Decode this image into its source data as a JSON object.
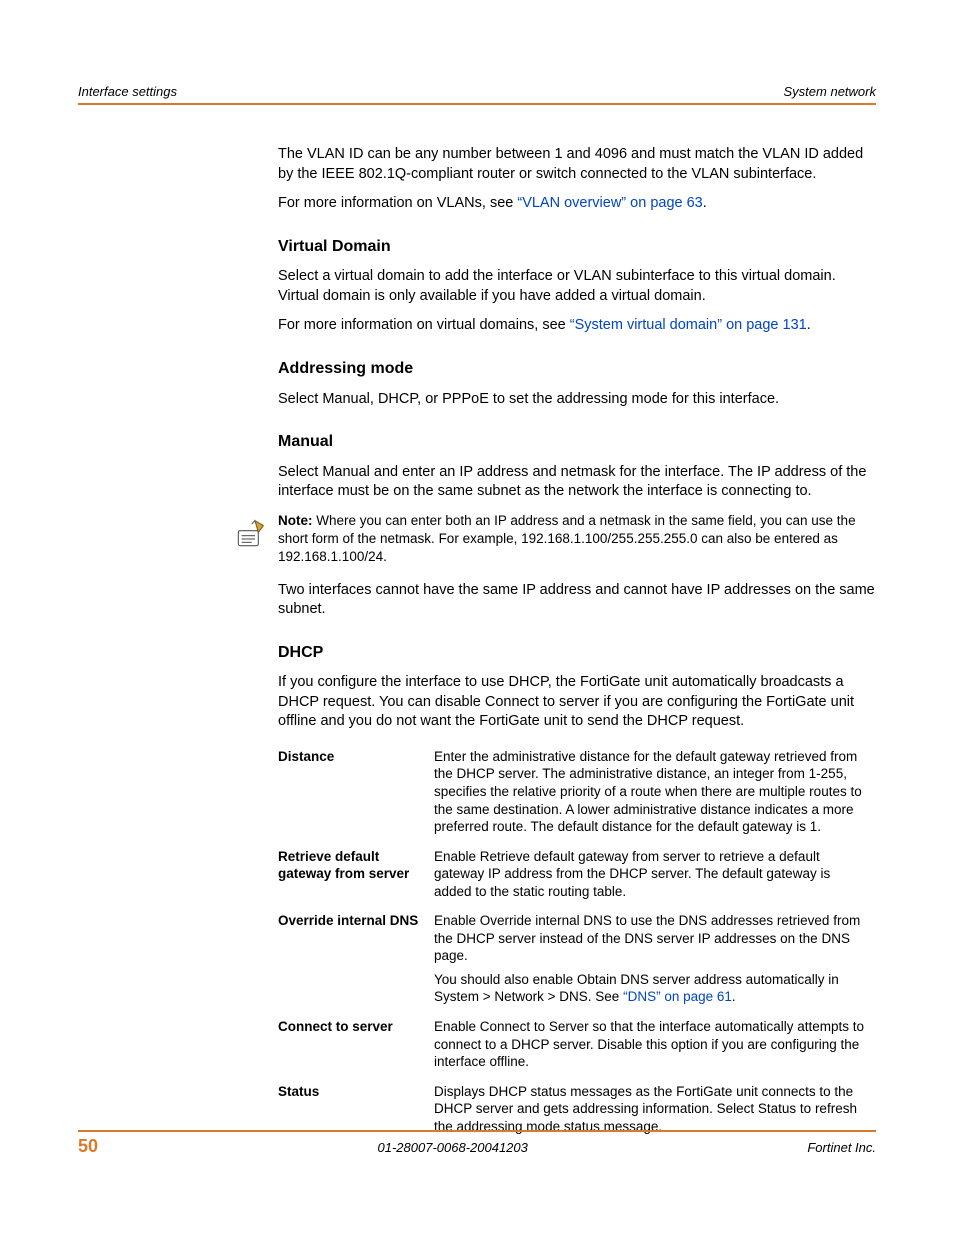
{
  "header": {
    "left": "Interface settings",
    "right": "System network"
  },
  "body": {
    "p1": "The VLAN ID can be any number between 1 and 4096 and must match the VLAN ID added by the IEEE 802.1Q-compliant router or switch connected to the VLAN subinterface.",
    "p2a": "For more information on VLANs, see ",
    "p2link": "“VLAN overview” on page 63",
    "p2b": ".",
    "h_vdom": "Virtual Domain",
    "vdom_p1": "Select a virtual domain to add the interface or VLAN subinterface to this virtual domain. Virtual domain is only available if you have added a virtual domain.",
    "vdom_p2a": "For more information on virtual domains, see ",
    "vdom_p2link": "“System virtual domain” on page 131",
    "vdom_p2b": ".",
    "h_addr": "Addressing mode",
    "addr_p1": "Select Manual, DHCP, or PPPoE to set the addressing mode for this interface.",
    "h_manual": "Manual",
    "manual_p1": "Select Manual and enter an IP address and netmask for the interface. The IP address of the interface must be on the same subnet as the network the interface is connecting to.",
    "note_label": "Note:",
    "note_text": " Where you can enter both an IP address and a netmask in the same field, you can use the short form of the netmask. For example, 192.168.1.100/255.255.255.0 can also be entered as 192.168.1.100/24.",
    "manual_p2": "Two interfaces cannot have the same IP address and cannot have IP addresses on the same subnet.",
    "h_dhcp": "DHCP",
    "dhcp_p1": "If you configure the interface to use DHCP, the FortiGate unit automatically broadcasts a DHCP request. You can disable Connect to server if you are configuring the FortiGate unit offline and you do not want the FortiGate unit to send the DHCP request.",
    "tbl": {
      "r1t": "Distance",
      "r1d": "Enter the administrative distance for the default gateway retrieved from the DHCP server. The administrative distance, an integer from 1-255, specifies the relative priority of a route when there are multiple routes to the same destination. A lower administrative distance indicates a more preferred route. The default distance for the default gateway is 1.",
      "r2t": "Retrieve default gateway from server",
      "r2d": "Enable Retrieve default gateway from server to retrieve a default gateway IP address from the DHCP server. The default gateway is added to the static routing table.",
      "r3t": "Override internal DNS",
      "r3d1": "Enable Override internal DNS to use the DNS addresses retrieved from the DHCP server instead of the DNS server IP addresses on the DNS page.",
      "r3d2a": "You should also enable Obtain DNS server address automatically in System > Network > DNS. See ",
      "r3d2link": "“DNS” on page 61",
      "r3d2b": ".",
      "r4t": "Connect to server",
      "r4d": "Enable Connect to Server so that the interface automatically attempts to connect to a DHCP server. Disable this option if you are configuring the interface offline.",
      "r5t": "Status",
      "r5d": "Displays DHCP status messages as the FortiGate unit connects to the DHCP server and gets addressing information. Select Status to refresh the addressing mode status message."
    }
  },
  "footer": {
    "page": "50",
    "docid": "01-28007-0068-20041203",
    "brand": "Fortinet Inc."
  }
}
